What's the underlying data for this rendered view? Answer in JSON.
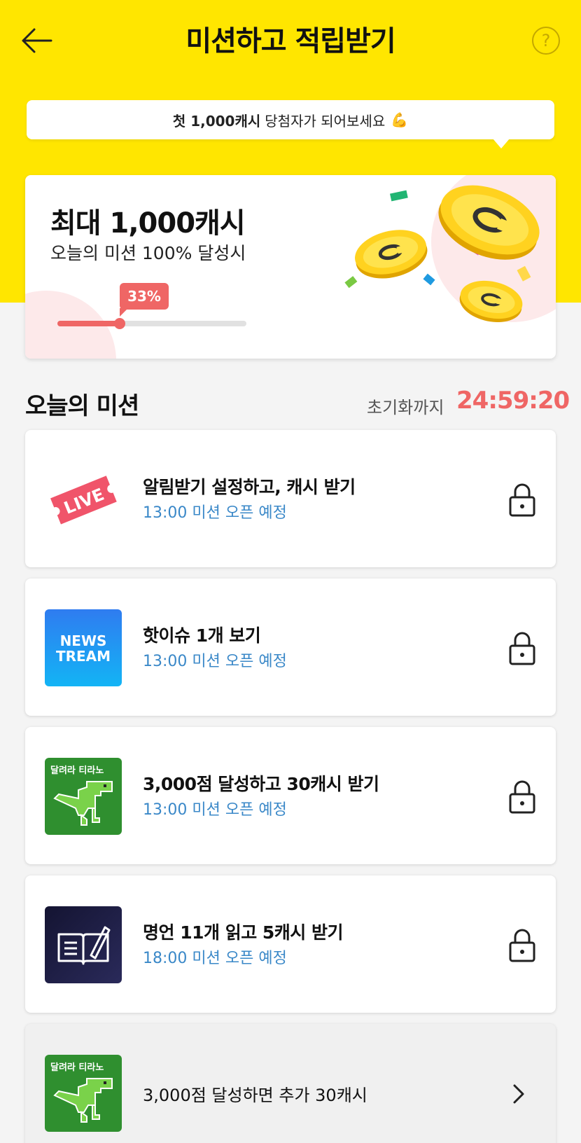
{
  "header": {
    "title": "미션하고 적립받기",
    "help_label": "?"
  },
  "tooltip": {
    "bold": "첫 1,000캐시",
    "text": "당첨자가 되어보세요",
    "emoji": "💪"
  },
  "reward": {
    "title": "최대 1,000캐시",
    "subtitle": "오늘의 미션 100% 달성시",
    "progress_label": "33%",
    "progress": 0.33
  },
  "section": {
    "title": "오늘의 미션",
    "reset_label": "초기화까지",
    "reset_timer": "24:59:20"
  },
  "missions": [
    {
      "icon": "live-icon",
      "icon_text": "LIVE",
      "title": "알림받기 설정하고, 캐시 받기",
      "status": "13:00 미션 오픈 예정",
      "locked": true
    },
    {
      "icon": "newstream-icon",
      "icon_text_1": "NEWS",
      "icon_text_2": "TREAM",
      "title": "핫이슈 1개 보기",
      "status": "13:00 미션 오픈 예정",
      "locked": true
    },
    {
      "icon": "dino-game-icon",
      "icon_text": "달려라 티라노",
      "title": "3,000점 달성하고 30캐시 받기",
      "status": "13:00 미션 오픈 예정",
      "locked": true
    },
    {
      "icon": "quote-book-icon",
      "title": "명언 11개 읽고 5캐시 받기",
      "status": "18:00 미션 오픈 예정",
      "locked": true
    },
    {
      "icon": "dino-game-icon",
      "icon_text": "달려라 티라노",
      "title": "3,000점 달성하면 추가 30캐시",
      "locked": false
    }
  ],
  "colors": {
    "brand_yellow": "#ffe600",
    "accent_red": "#ef6665",
    "status_blue": "#3a88c8"
  }
}
